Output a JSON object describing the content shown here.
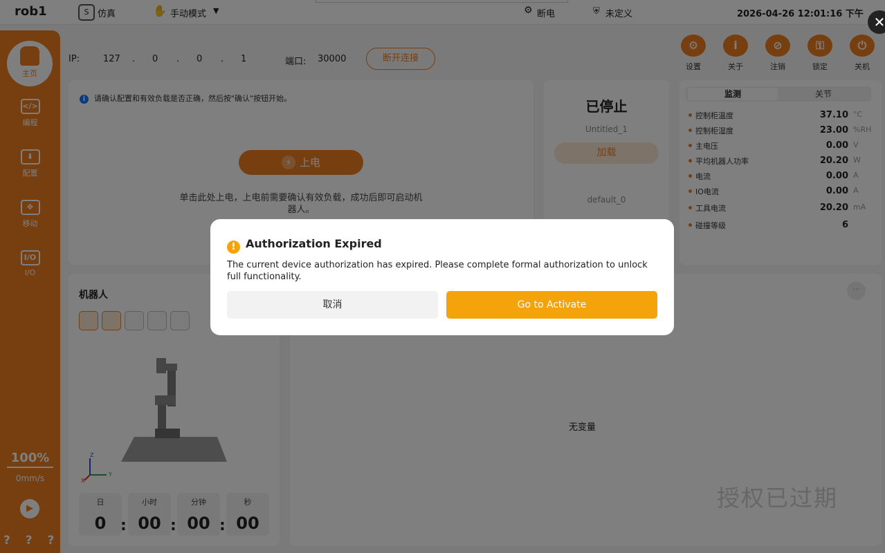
{
  "topbar": {
    "app_name": "rob1",
    "sim_label": "仿真",
    "mode_label": "手动模式",
    "power_state": "断电",
    "tool_state": "未定义",
    "datetime": "2026-04-26 12:01:16 下午"
  },
  "sidebar": {
    "items": [
      {
        "label": "主页",
        "icon": "home-icon"
      },
      {
        "label": "编程",
        "icon": "code-icon"
      },
      {
        "label": "配置",
        "icon": "config-icon"
      },
      {
        "label": "移动",
        "icon": "move-icon"
      },
      {
        "label": "I/O",
        "icon": "io-icon"
      }
    ],
    "io_icon_text": "I/O",
    "speed_percent": "100%",
    "speed_value": "0mm/s",
    "help_text": "? ? ? ?"
  },
  "connection": {
    "ip_label": "IP:",
    "ip_parts": [
      "127",
      ".",
      "0",
      ".",
      "0",
      ".",
      "1"
    ],
    "port_label": "端口:",
    "port_value": "30000",
    "disconnect_label": "断开连接"
  },
  "toolbar": {
    "items": [
      "设置",
      "关于",
      "注销",
      "锁定",
      "关机"
    ]
  },
  "power_panel": {
    "info": "请确认配置和有效负载是否正确，然后按\"确认\"按钮开始。",
    "power_button": "上电",
    "hint": "单击此处上电，上电前需要确认有效负载，成功后即可启动机器人。"
  },
  "program_panel": {
    "status": "已停止",
    "program_name": "Untitled_1",
    "load_button": "加载",
    "default_name": "default_0"
  },
  "monitor": {
    "tabs": [
      "监测",
      "关节"
    ],
    "rows": [
      {
        "label": "控制柜温度",
        "value": "37.10",
        "unit": "°C"
      },
      {
        "label": "控制柜湿度",
        "value": "23.00",
        "unit": "%RH"
      },
      {
        "label": "主电压",
        "value": "0.00",
        "unit": "V"
      },
      {
        "label": "平均机器人功率",
        "value": "20.20",
        "unit": "W"
      },
      {
        "label": "电流",
        "value": "0.00",
        "unit": "A"
      },
      {
        "label": "IO电流",
        "value": "0.00",
        "unit": "A"
      },
      {
        "label": "工具电流",
        "value": "20.20",
        "unit": "mA"
      },
      {
        "label": "碰撞等级",
        "value": "6",
        "unit": ""
      }
    ]
  },
  "robot_panel": {
    "title": "机器人",
    "axes": {
      "x": "X",
      "y": "Y",
      "z": "Z"
    },
    "time": [
      {
        "label": "日",
        "value": "0"
      },
      {
        "label": "小时",
        "value": "00"
      },
      {
        "label": "分钟",
        "value": "00"
      },
      {
        "label": "秒",
        "value": "00"
      }
    ],
    "separator": ":"
  },
  "variables_panel": {
    "empty_text": "无变量",
    "more_label": "···",
    "watermark": "授权已过期"
  },
  "dialog": {
    "title": "Authorization Expired",
    "message": "The current device authorization has expired. Please complete formal authorization to unlock full functionality.",
    "cancel_label": "取消",
    "activate_label": "Go to Activate"
  }
}
